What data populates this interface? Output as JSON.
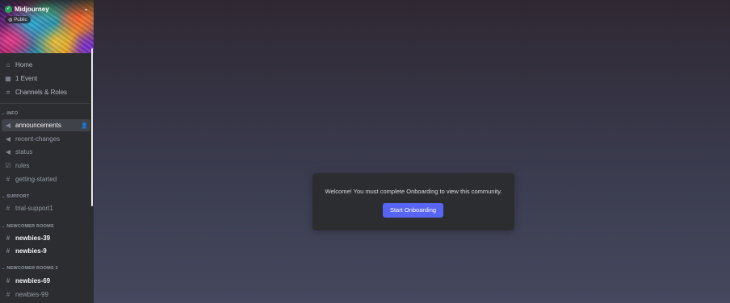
{
  "server": {
    "name": "Midjourney",
    "badge": "Public"
  },
  "nav": [
    {
      "label": "Home",
      "icon": "home-icon"
    },
    {
      "label": "1 Event",
      "icon": "calendar-icon"
    },
    {
      "label": "Channels & Roles",
      "icon": "channels-roles-icon"
    }
  ],
  "categories": {
    "info": "INFO",
    "support": "SUPPORT",
    "newcomer": "NEWCOMER ROOMS",
    "newcomer2": "NEWCOMER ROOMS 2"
  },
  "channels": {
    "announcements": "announcements",
    "recent_changes": "recent-changes",
    "status": "status",
    "rules": "rules",
    "getting_started": "getting-started",
    "trial_support": "trial-support1",
    "newbies_39": "newbies-39",
    "newbies_9": "newbies-9",
    "newbies_69": "newbies-69",
    "newbies_99": "newbies-99"
  },
  "modal": {
    "message": "Welcome! You must complete Onboarding to view this community.",
    "button": "Start Onboarding"
  },
  "colors": {
    "accent": "#5865f2",
    "sidebar_bg": "#2b2d31",
    "verified": "#23a55a"
  }
}
